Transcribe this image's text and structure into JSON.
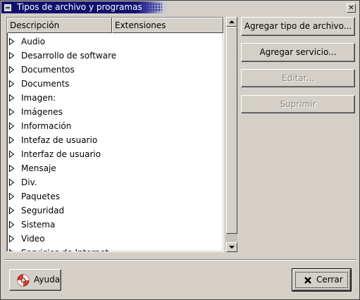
{
  "window": {
    "title": "Tipos de archivo y programas",
    "close_glyph": "✕"
  },
  "list": {
    "columns": [
      "Descripción",
      "Extensiones"
    ],
    "rows": [
      "Audio",
      "Desarrollo de software",
      "Documentos",
      "Documents",
      "Imagen:",
      "Imágenes",
      "Información",
      "Intefaz de usuario",
      "Interfaz de usuario",
      "Mensaje",
      "Div.",
      "Paquetes",
      "Seguridad",
      "Sistema",
      "Video",
      "Servicios de Internet"
    ]
  },
  "buttons": {
    "add_type": "Agregar tipo de archivo...",
    "add_service": "Agregar servicio...",
    "edit": "Editar...",
    "delete": "Suprimir",
    "help": "Ayuda",
    "close": "Cerrar"
  },
  "icons": {
    "row_expander": "triangle-right-icon",
    "help": "lifebuoy-icon",
    "close": "x-icon"
  }
}
